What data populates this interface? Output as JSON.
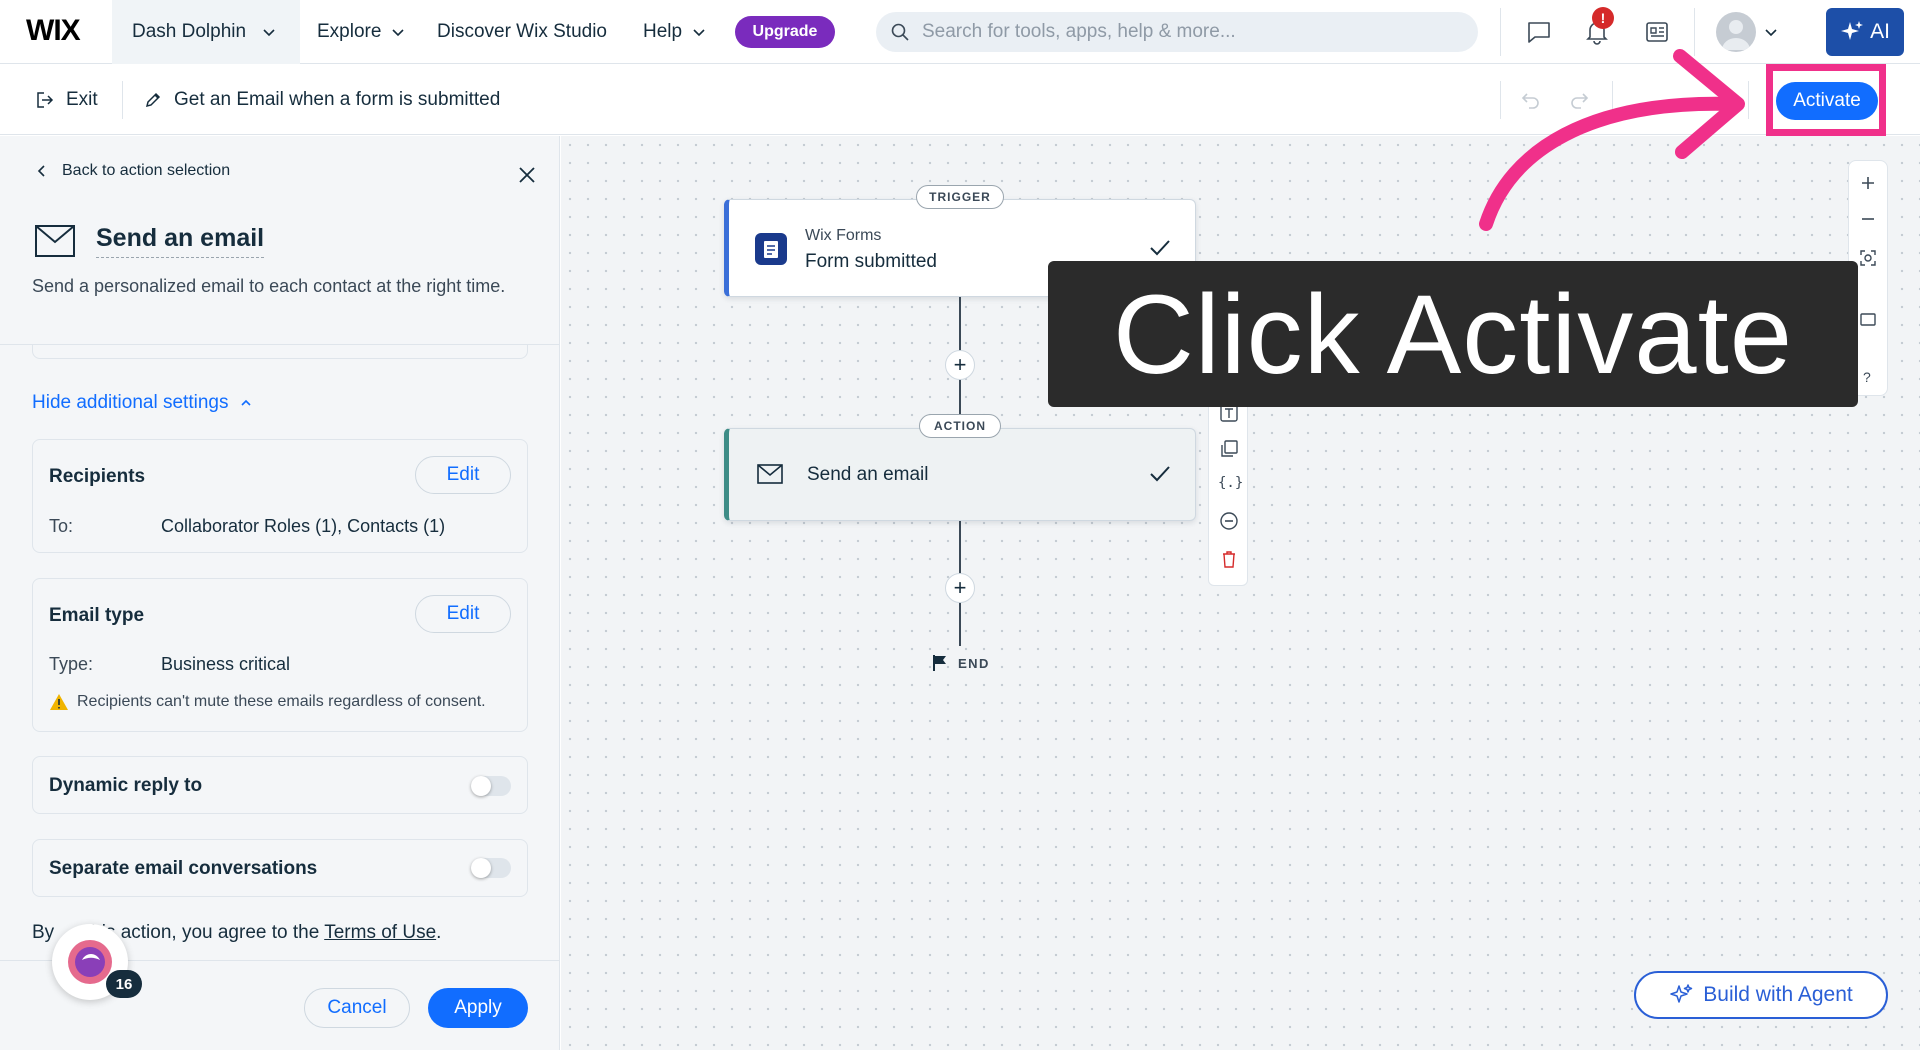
{
  "topbar": {
    "logo": "WIX",
    "site_name": "Dash Dolphin",
    "nav": [
      "Explore",
      "Discover Wix Studio",
      "Help"
    ],
    "upgrade_label": "Upgrade",
    "search_placeholder": "Search for tools, apps, help & more...",
    "notification_count": "!",
    "ai_label": "AI"
  },
  "subbar": {
    "exit_label": "Exit",
    "flow_name": "Get an Email when a form is submitted",
    "activate_label": "Activate"
  },
  "panel": {
    "back_label": "Back to action selection",
    "action_title": "Send an email",
    "action_desc": "Send a personalized email to each contact at the right time.",
    "hide_settings_label": "Hide additional settings",
    "recipients": {
      "title": "Recipients",
      "edit_label": "Edit",
      "to_key": "To:",
      "to_value": "Collaborator Roles (1), Contacts (1)"
    },
    "email_type": {
      "title": "Email type",
      "edit_label": "Edit",
      "type_key": "Type:",
      "type_value": "Business critical",
      "warning": "Recipients can't mute these emails regardless of consent."
    },
    "dynamic_reply_label": "Dynamic reply to",
    "separate_conv_label": "Separate email conversations",
    "terms_prefix": "By      this action, you agree to the ",
    "terms_link": "Terms of Use",
    "terms_suffix": ".",
    "cancel_label": "Cancel",
    "apply_label": "Apply",
    "bubble_count": "16"
  },
  "canvas": {
    "trigger_pill": "TRIGGER",
    "trigger_app": "Wix Forms",
    "trigger_event": "Form submitted",
    "action_pill": "ACTION",
    "action_name": "Send an email",
    "end_label": "END",
    "zoom_help": "?",
    "overlay_text": "Click Activate",
    "build_agent_label": "Build with Agent"
  },
  "colors": {
    "accent": "#116dff",
    "upgrade": "#7a2bbd",
    "highlight": "#f0308a",
    "overlay_bg": "#2b2b2b",
    "trigger_bar": "#3b6fd8",
    "action_bar": "#3d8c86"
  }
}
